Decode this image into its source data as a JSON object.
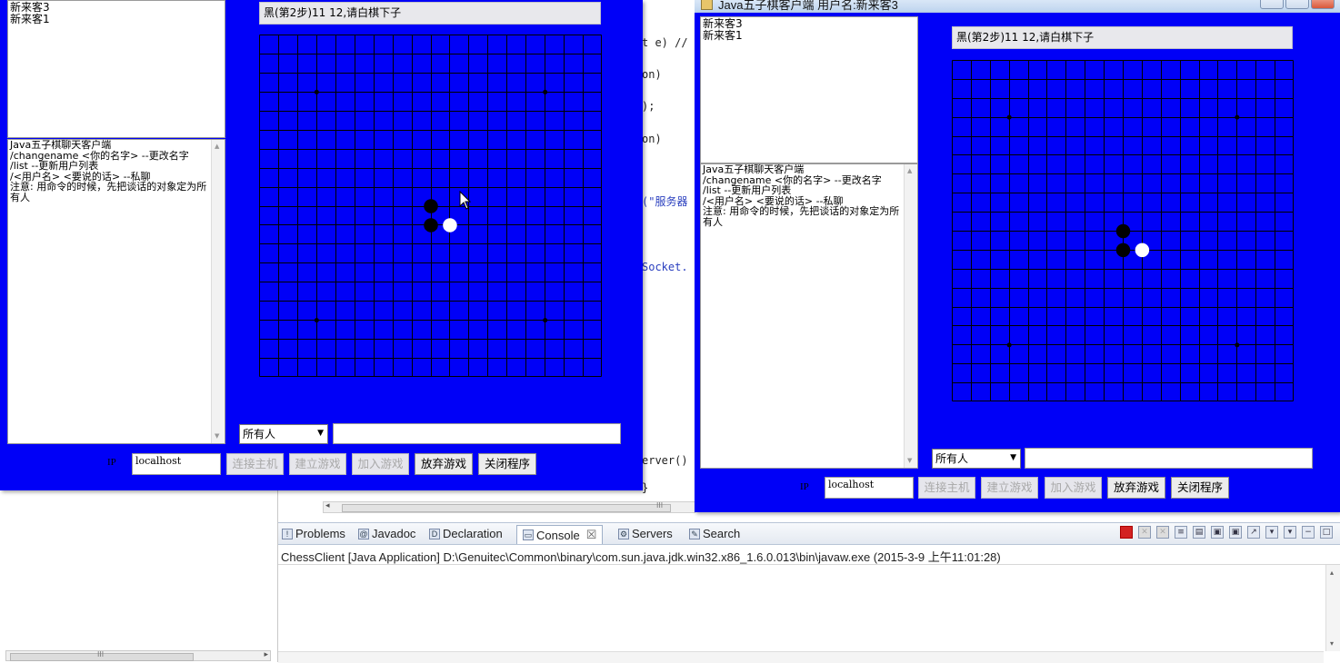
{
  "ide": {
    "code_fragments": [
      {
        "text": "t e) //",
        "blue": false
      },
      {
        "text": "on)",
        "blue": false
      },
      {
        "text": ");",
        "blue": false
      },
      {
        "text": "on)",
        "blue": false
      },
      {
        "text": "(\"服务器",
        "blue": true
      },
      {
        "text": "Socket.",
        "blue": true
      },
      {
        "text": "erver()",
        "blue": false
      },
      {
        "text": "}",
        "blue": false
      }
    ],
    "scroll_marker": "III",
    "console_tabs": [
      {
        "label": "Problems",
        "icon": "problems-icon"
      },
      {
        "label": "Javadoc",
        "icon": "at-icon"
      },
      {
        "label": "Declaration",
        "icon": "declaration-icon"
      },
      {
        "label": "Console",
        "icon": "console-icon"
      },
      {
        "label": "Servers",
        "icon": "servers-icon"
      },
      {
        "label": "Search",
        "icon": "search-icon"
      }
    ],
    "console_close_glyph": "☒",
    "console_description": "ChessClient [Java Application] D:\\Genuitec\\Common\\binary\\com.sun.java.jdk.win32.x86_1.6.0.013\\bin\\javaw.exe (2015-3-9 上午11:01:28)"
  },
  "window1": {
    "users": [
      "新来客3",
      "新来客1"
    ],
    "status": "黑(第2步)11 12,请白棋下子",
    "chat": [
      "Java五子棋聊天客户端",
      "/changename <你的名字> --更改名字",
      "/list --更新用户列表",
      "/<用户名> <要说的话> --私聊",
      "注意: 用命令的时候，先把谈话的对象定为所有人"
    ],
    "target_select": "所有人",
    "ip_label": "IP",
    "ip_value": "localhost",
    "buttons": {
      "connect": "连接主机",
      "create": "建立游戏",
      "join": "加入游戏",
      "giveup": "放弃游戏",
      "close": "关闭程序"
    }
  },
  "window2": {
    "title": "Java五子棋客户端 用户名:新来客3",
    "users": [
      "新来客3",
      "新来客1"
    ],
    "status": "黑(第2步)11 12,请白棋下子",
    "chat": [
      "Java五子棋聊天客户端",
      "/changename <你的名字> --更改名字",
      "/list --更新用户列表",
      "/<用户名> <要说的话> --私聊",
      "注意: 用命令的时候，先把谈话的对象定为所有人"
    ],
    "target_select": "所有人",
    "ip_label": "IP",
    "ip_value": "localhost",
    "buttons": {
      "connect": "连接主机",
      "create": "建立游戏",
      "join": "加入游戏",
      "giveup": "放弃游戏",
      "close": "关闭程序"
    }
  },
  "board": {
    "lines": 19,
    "star_points": [
      [
        3,
        3
      ],
      [
        15,
        3
      ],
      [
        3,
        15
      ],
      [
        15,
        15
      ]
    ],
    "stones": [
      {
        "col": 9,
        "row": 9,
        "color": "black"
      },
      {
        "col": 9,
        "row": 10,
        "color": "black"
      },
      {
        "col": 10,
        "row": 10,
        "color": "white"
      }
    ]
  },
  "colors": {
    "frame_blue": "#0000f7",
    "grid_line": "#000000",
    "black_stone": "#000000",
    "white_stone": "#ffffff"
  }
}
